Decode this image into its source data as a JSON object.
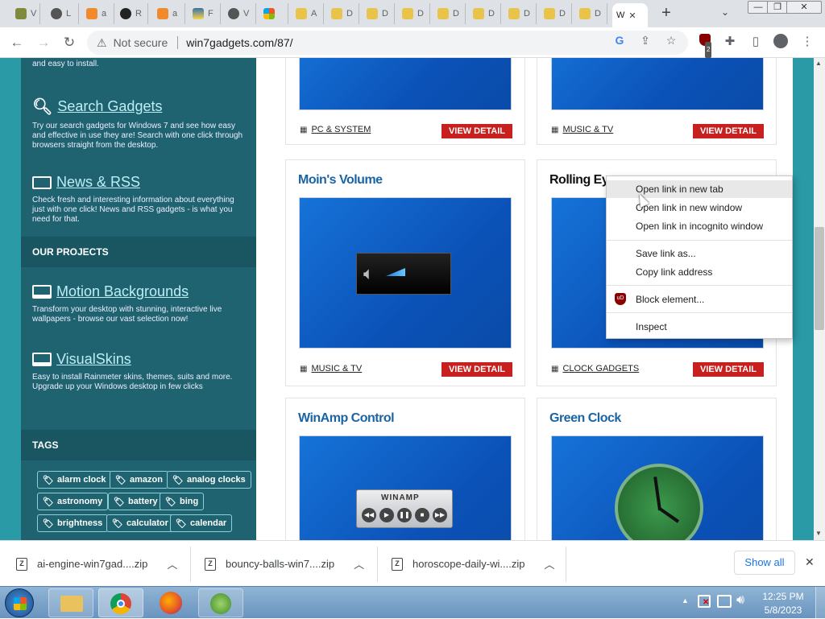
{
  "tabs": {
    "inactive_labels": [
      "V",
      "L",
      "a",
      "R",
      "a",
      "F",
      "V",
      "",
      "A",
      "D",
      "D",
      "D",
      "D",
      "D",
      "D",
      "D"
    ],
    "active_label": "W",
    "new_tab": "+",
    "search_tabs": "⌄"
  },
  "window": {
    "minimize": "—",
    "restore": "❐",
    "close": "✕"
  },
  "toolbar": {
    "security_label": "Not secure",
    "url": "win7gadgets.com/87/",
    "extension_badge": "2"
  },
  "sidebar": {
    "partial_text": "and easy to install.",
    "search": {
      "title": "Search Gadgets",
      "desc": "Try our search gadgets for Windows 7 and see how easy and effective in use they are! Search with one click through browsers straight from the desktop."
    },
    "news": {
      "title": "News & RSS",
      "desc": "Check fresh and interesting information about everything just with one click! News and RSS gadgets - is what you need for that."
    },
    "projects_heading": "OUR PROJECTS",
    "motion": {
      "title": "Motion Backgrounds",
      "desc": "Transform your desktop with stunning, interactive live wallpapers - browse our vast selection now!"
    },
    "visualskins": {
      "title": "VisualSkins",
      "desc": "Easy to install Rainmeter skins, themes, suits and more. Upgrade up your Windows desktop in few clicks"
    },
    "tags_heading": "TAGS",
    "tags": [
      "alarm clock",
      "amazon",
      "analog clocks",
      "astronomy",
      "battery",
      "bing",
      "brightness",
      "calculator",
      "calendar"
    ]
  },
  "cards": [
    {
      "title": "",
      "category": "PC & SYSTEM",
      "button": "VIEW DETAIL",
      "partial_screen": "0%"
    },
    {
      "title": "",
      "category": "MUSIC & TV",
      "button": "VIEW DETAIL"
    },
    {
      "title": "Moin's Volume",
      "category": "MUSIC & TV",
      "button": "VIEW DETAIL"
    },
    {
      "title": "Rolling Eye",
      "category": "CLOCK GADGETS",
      "button": "VIEW DETAIL"
    },
    {
      "title": "WinAmp Control",
      "category": "",
      "button": "",
      "winamp_logo": "WINAMP"
    },
    {
      "title": "Green Clock",
      "category": "",
      "button": ""
    }
  ],
  "context_menu": {
    "items": [
      "Open link in new tab",
      "Open link in new window",
      "Open link in incognito window",
      "Save link as...",
      "Copy link address",
      "Block element...",
      "Inspect"
    ],
    "ublock_badge": "uD"
  },
  "downloads": {
    "items": [
      "ai-engine-win7gad....zip",
      "bouncy-balls-win7....zip",
      "horoscope-daily-wi....zip"
    ],
    "show_all": "Show all",
    "close": "✕"
  },
  "taskbar": {
    "time": "12:25 PM",
    "date": "5/8/2023"
  },
  "colors": {
    "accent_red": "#c8201e",
    "link_blue": "#1a64a3",
    "sidebar_teal": "#1f6370"
  }
}
